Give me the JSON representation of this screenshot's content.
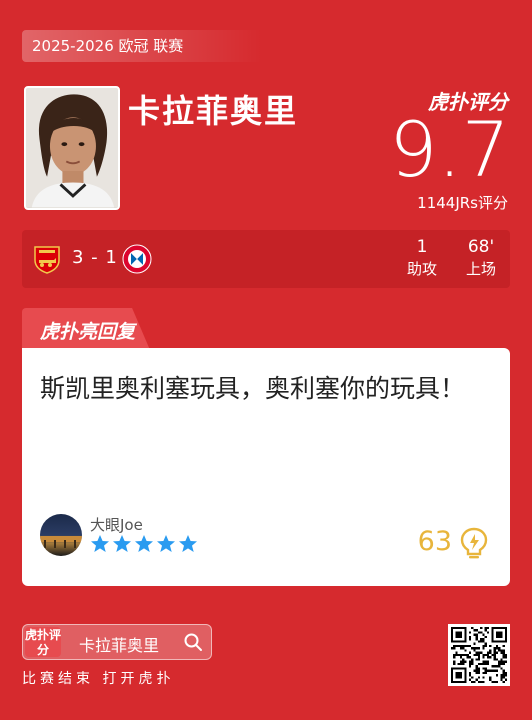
{
  "header": {
    "season": "2025-2026 欧冠 联赛"
  },
  "player": {
    "name": "卡拉菲奥里"
  },
  "rating": {
    "brand": "虎扑评分",
    "score": "9.7",
    "count": "1144JRs评分"
  },
  "match": {
    "score": "3 - 1",
    "home_team_icon": "arsenal-crest-icon",
    "away_team_icon": "bayern-crest-icon",
    "assists_value": "1",
    "assists_label": "助攻",
    "minutes_value": "68'",
    "minutes_label": "上场"
  },
  "reply": {
    "tab_label": "虎扑亮回复",
    "text": "斯凯里奥利塞玩具，奥利塞你的玩具！",
    "username": "大眼Joe",
    "stars": 5,
    "likes": "63"
  },
  "footer": {
    "search_logo": "虎扑评分",
    "search_text": "卡拉菲奥里",
    "slogan": "比赛结束 打开虎扑"
  },
  "colors": {
    "background": "#d62a2e",
    "star": "#2a9bf0",
    "likes": "#e8b53b"
  }
}
